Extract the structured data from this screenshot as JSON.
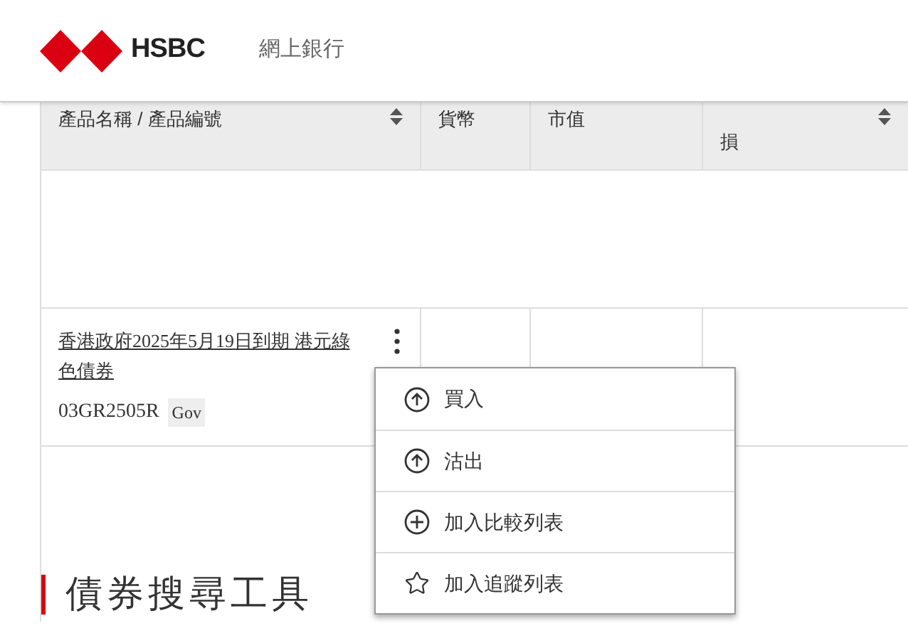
{
  "header": {
    "brand": "HSBC",
    "title": "網上銀行"
  },
  "table": {
    "columns": [
      {
        "label": "產品名稱 / 產品編號",
        "sortable": true
      },
      {
        "label": "貨幣",
        "sortable": false
      },
      {
        "label": "市值",
        "sortable": false
      },
      {
        "label": "損",
        "sortable": true
      }
    ],
    "rows": [
      {
        "name": "香港政府2025年5月19日到期 港元綠色債券",
        "code": "03GR2505R",
        "tag": "Gov"
      }
    ]
  },
  "menu": [
    {
      "kind": "up",
      "label": "買入"
    },
    {
      "kind": "up",
      "label": "沽出"
    },
    {
      "kind": "plus",
      "label": "加入比較列表"
    },
    {
      "kind": "star",
      "label": "加入追蹤列表"
    }
  ],
  "section_title": "債券搜尋工具"
}
